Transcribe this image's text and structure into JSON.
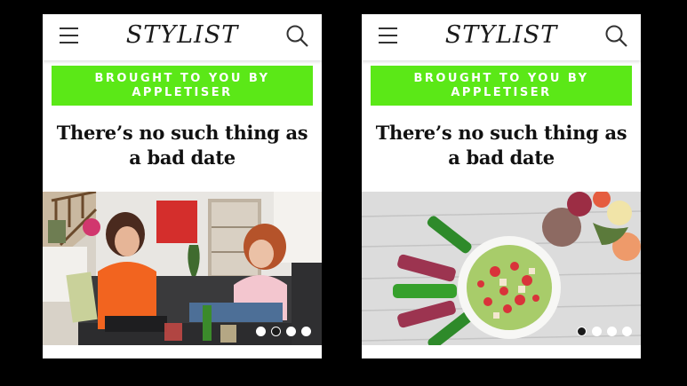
{
  "screens": [
    {
      "brand": "STYLIST",
      "banner": "BROUGHT TO YOU BY APPLETISER",
      "headline": "There’s no such thing as a bad date",
      "carousel": {
        "slides": 4,
        "active": 2,
        "image": "two women chatting on a sofa in a living room"
      }
    },
    {
      "brand": "STYLIST",
      "banner": "BROUGHT TO YOU BY APPLETISER",
      "headline": "There’s no such thing as a bad date",
      "carousel": {
        "slides": 4,
        "active": 1,
        "image": "salad bowl with Appletiser bottles and flowers on a wooden table"
      }
    }
  ],
  "icons": {
    "menu": "hamburger-menu-icon",
    "search": "search-icon"
  },
  "colors": {
    "banner": "#5be817",
    "background": "#000000"
  }
}
